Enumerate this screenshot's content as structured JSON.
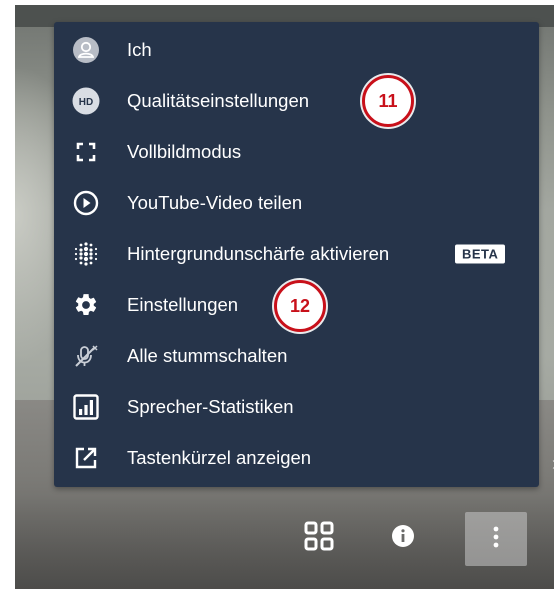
{
  "menu": {
    "items": [
      {
        "label": "Ich",
        "icon": "avatar-icon"
      },
      {
        "label": "Qualitätseinstellungen",
        "icon": "hd-icon"
      },
      {
        "label": "Vollbildmodus",
        "icon": "fullscreen-icon"
      },
      {
        "label": "YouTube-Video teilen",
        "icon": "play-circle-icon"
      },
      {
        "label": "Hintergrundunschärfe aktivieren",
        "icon": "blur-icon",
        "badge": "BETA"
      },
      {
        "label": "Einstellungen",
        "icon": "gear-icon"
      },
      {
        "label": "Alle stummschalten",
        "icon": "mic-off-icon"
      },
      {
        "label": "Sprecher-Statistiken",
        "icon": "bar-chart-icon"
      },
      {
        "label": "Tastenkürzel anzeigen",
        "icon": "external-link-icon"
      }
    ],
    "hd_text": "HD"
  },
  "annotations": [
    {
      "number": "11"
    },
    {
      "number": "12"
    }
  ],
  "toolbar": {
    "buttons": [
      {
        "icon": "tile-view-icon"
      },
      {
        "icon": "info-icon"
      },
      {
        "icon": "more-vertical-icon",
        "active": true
      }
    ]
  },
  "colors": {
    "menu_bg": "#26344a",
    "badge_red": "#c8101a"
  }
}
